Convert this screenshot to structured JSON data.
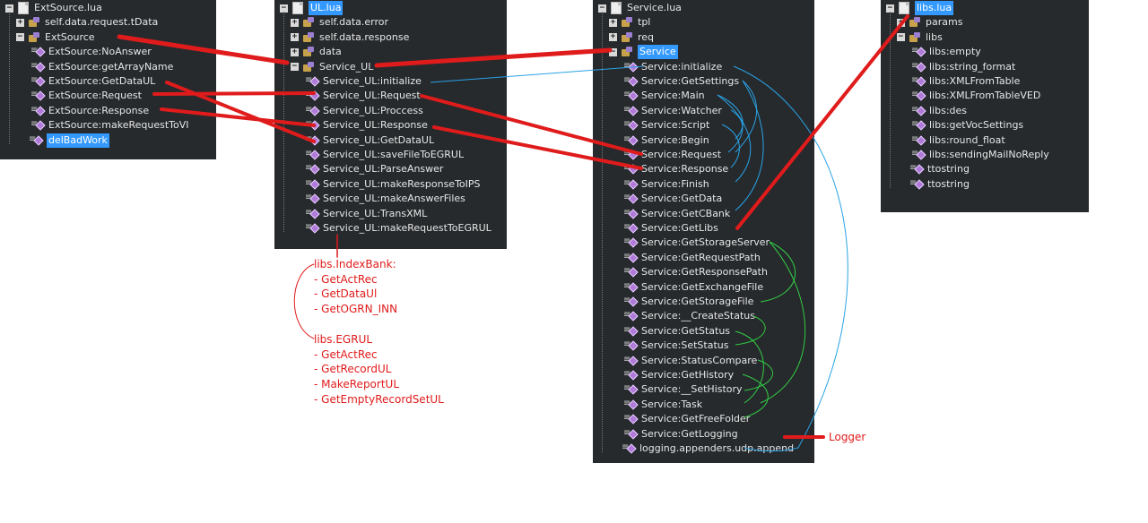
{
  "panels": {
    "ext": {
      "file": "ExtSource.lua",
      "rows": [
        {
          "label": "self.data.request.tData",
          "kind": "table",
          "toggle": "+",
          "level": 1
        },
        {
          "label": "ExtSource",
          "kind": "table",
          "toggle": "-",
          "level": 1
        },
        {
          "label": "ExtSource:NoAnswer",
          "kind": "func",
          "level": 2
        },
        {
          "label": "ExtSource:getArrayName",
          "kind": "func",
          "level": 2
        },
        {
          "label": "ExtSource:GetDataUL",
          "kind": "func",
          "level": 2
        },
        {
          "label": "ExtSource:Request",
          "kind": "func",
          "level": 2
        },
        {
          "label": "ExtSource:Response",
          "kind": "func",
          "level": 2
        },
        {
          "label": "ExtSource:makeRequestToVI",
          "kind": "func",
          "level": 2
        },
        {
          "label": "delBadWork",
          "kind": "func",
          "level": 1,
          "selected": true
        }
      ]
    },
    "ul": {
      "file": "UL.lua",
      "file_selected": true,
      "rows": [
        {
          "label": "self.data.error",
          "kind": "table",
          "toggle": "+",
          "level": 1
        },
        {
          "label": "self.data.response",
          "kind": "table",
          "toggle": "+",
          "level": 1
        },
        {
          "label": "data",
          "kind": "table",
          "toggle": "+",
          "level": 1
        },
        {
          "label": "Service_UL",
          "kind": "table",
          "toggle": "-",
          "level": 1
        },
        {
          "label": "Service_UL:initialize",
          "kind": "func",
          "level": 2
        },
        {
          "label": "Service_UL:Request",
          "kind": "func",
          "level": 2
        },
        {
          "label": "Service_UL:Proccess",
          "kind": "func",
          "level": 2
        },
        {
          "label": "Service_UL:Response",
          "kind": "func",
          "level": 2
        },
        {
          "label": "Service_UL:GetDataUL",
          "kind": "func",
          "level": 2
        },
        {
          "label": "Service_UL:saveFileToEGRUL",
          "kind": "func",
          "level": 2
        },
        {
          "label": "Service_UL:ParseAnswer",
          "kind": "func",
          "level": 2
        },
        {
          "label": "Service_UL:makeResponseToIPS",
          "kind": "func",
          "level": 2
        },
        {
          "label": "Service_UL:makeAnswerFiles",
          "kind": "func",
          "level": 2
        },
        {
          "label": "Service_UL:TransXML",
          "kind": "func",
          "level": 2
        },
        {
          "label": "Service_UL:makeRequestToEGRUL",
          "kind": "func",
          "level": 2
        }
      ]
    },
    "service": {
      "file": "Service.lua",
      "rows": [
        {
          "label": "tpl",
          "kind": "table",
          "toggle": "+",
          "level": 1
        },
        {
          "label": "req",
          "kind": "table",
          "toggle": "+",
          "level": 1
        },
        {
          "label": "Service",
          "kind": "table",
          "toggle": "-",
          "level": 1,
          "selected": true
        },
        {
          "label": "Service:initialize",
          "kind": "func",
          "level": 2
        },
        {
          "label": "Service:GetSettings",
          "kind": "func",
          "level": 2
        },
        {
          "label": "Service:Main",
          "kind": "func",
          "level": 2
        },
        {
          "label": "Service:Watcher",
          "kind": "func",
          "level": 2
        },
        {
          "label": "Service:Script",
          "kind": "func",
          "level": 2
        },
        {
          "label": "Service:Begin",
          "kind": "func",
          "level": 2
        },
        {
          "label": "Service:Request",
          "kind": "func",
          "level": 2
        },
        {
          "label": "Service:Response",
          "kind": "func",
          "level": 2
        },
        {
          "label": "Service:Finish",
          "kind": "func",
          "level": 2
        },
        {
          "label": "Service:GetData",
          "kind": "func",
          "level": 2
        },
        {
          "label": "Service:GetCBank",
          "kind": "func",
          "level": 2
        },
        {
          "label": "Service:GetLibs",
          "kind": "func",
          "level": 2
        },
        {
          "label": "Service:GetStorageServer",
          "kind": "func",
          "level": 2
        },
        {
          "label": "Service:GetRequestPath",
          "kind": "func",
          "level": 2
        },
        {
          "label": "Service:GetResponsePath",
          "kind": "func",
          "level": 2
        },
        {
          "label": "Service:GetExchangeFile",
          "kind": "func",
          "level": 2
        },
        {
          "label": "Service:GetStorageFile",
          "kind": "func",
          "level": 2
        },
        {
          "label": "Service:__CreateStatus",
          "kind": "func",
          "level": 2
        },
        {
          "label": "Service:GetStatus",
          "kind": "func",
          "level": 2
        },
        {
          "label": "Service:SetStatus",
          "kind": "func",
          "level": 2
        },
        {
          "label": "Service:StatusCompare",
          "kind": "func",
          "level": 2
        },
        {
          "label": "Service:GetHistory",
          "kind": "func",
          "level": 2
        },
        {
          "label": "Service:__SetHistory",
          "kind": "func",
          "level": 2
        },
        {
          "label": "Service:Task",
          "kind": "func",
          "level": 2
        },
        {
          "label": "Service:GetFreeFolder",
          "kind": "func",
          "level": 2
        },
        {
          "label": "Service:GetLogging",
          "kind": "func",
          "level": 2
        },
        {
          "label": "logging.appenders.udp.append",
          "kind": "func",
          "level": 1
        }
      ]
    },
    "libs": {
      "file": "libs.lua",
      "file_selected": true,
      "rows": [
        {
          "label": "params",
          "kind": "table",
          "toggle": "+",
          "level": 1
        },
        {
          "label": "libs",
          "kind": "table",
          "toggle": "-",
          "level": 1
        },
        {
          "label": "libs:empty",
          "kind": "func",
          "level": 2
        },
        {
          "label": "libs:string_format",
          "kind": "func",
          "level": 2
        },
        {
          "label": "libs:XMLFromTable",
          "kind": "func",
          "level": 2
        },
        {
          "label": "libs:XMLFromTableVED",
          "kind": "func",
          "level": 2
        },
        {
          "label": "libs:des",
          "kind": "func",
          "level": 2
        },
        {
          "label": "libs:getVocSettings",
          "kind": "func",
          "level": 2
        },
        {
          "label": "libs:round_float",
          "kind": "func",
          "level": 2
        },
        {
          "label": "libs:sendingMailNoReply",
          "kind": "func",
          "level": 2
        },
        {
          "label": "ttostring",
          "kind": "func",
          "level": 1
        },
        {
          "label": "ttostring",
          "kind": "func",
          "level": 1
        }
      ]
    }
  },
  "notes": {
    "indexbank": {
      "title": "libs.IndexBank:",
      "items": [
        "- GetActRec",
        "- GetDataUl",
        "- GetOGRN_INN"
      ]
    },
    "egrul": {
      "title": "libs.EGRUL",
      "items": [
        "- GetActRec",
        "- GetRecordUL",
        "- MakeReportUL",
        "- GetEmptyRecordSetUL"
      ]
    },
    "logger": "Logger"
  },
  "colors": {
    "panel_bg": "#262a2d",
    "selection": "#3399ff",
    "red_links": "#e01b1b",
    "blue_links": "#29a3e6",
    "green_links": "#33cc44"
  }
}
